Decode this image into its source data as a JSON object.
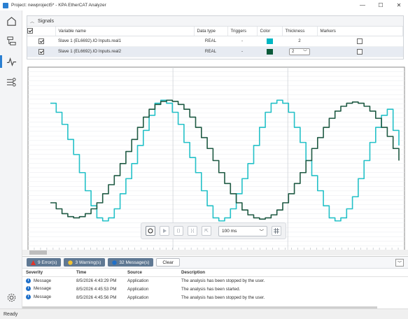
{
  "window": {
    "title": "Project: newproject5* - KPA EtherCAT Analyzer",
    "controls": [
      "—",
      "☐",
      "✕"
    ]
  },
  "sidebar": {
    "items": [
      {
        "icon": "home-icon"
      },
      {
        "icon": "topology-icon"
      },
      {
        "icon": "analyzer-icon",
        "active": true
      },
      {
        "icon": "mapping-icon"
      },
      {
        "icon": "settings-icon"
      }
    ]
  },
  "signals": {
    "header": "Signals",
    "columns": [
      "Variable name",
      "Data type",
      "Triggers",
      "Color",
      "Thickness",
      "Markers"
    ],
    "rows": [
      {
        "name": "Slave 1 (EL6692).IO Inputs.real1",
        "type": "REAL",
        "triggers": "-",
        "color": "#00b7c3",
        "thickness": "2",
        "checked": true
      },
      {
        "name": "Slave 1 (EL6692).IO Inputs.real2",
        "type": "REAL",
        "triggers": "-",
        "color": "#0b5a3a",
        "thickness": "2",
        "checked": true
      }
    ]
  },
  "chart_data": {
    "type": "line",
    "x": [
      0,
      1,
      2,
      3,
      4,
      5,
      6,
      7,
      8,
      9,
      10,
      11,
      12,
      13,
      14,
      15,
      16,
      17,
      18,
      19,
      20,
      21,
      22,
      23,
      24,
      25,
      26,
      27,
      28,
      29,
      30,
      31,
      32,
      33,
      34,
      35,
      36,
      37,
      38,
      39,
      40,
      41,
      42,
      43,
      44,
      45,
      46,
      47,
      48,
      49,
      50,
      51,
      52,
      53,
      54,
      55,
      56,
      57,
      58,
      59,
      60
    ],
    "ylim": [
      -1.2,
      1.2
    ],
    "grid": true,
    "series": [
      {
        "color": "#24c1c8",
        "values": [
          0.95,
          0.8,
          0.6,
          0.35,
          0.1,
          -0.2,
          -0.5,
          -0.75,
          -0.95,
          -1.0,
          -0.95,
          -0.8,
          -0.55,
          -0.3,
          -0.05,
          0.25,
          0.5,
          0.75,
          0.95,
          1.0,
          0.95,
          0.8,
          0.6,
          0.3,
          0.05,
          -0.2,
          -0.5,
          -0.75,
          -0.95,
          -1.0,
          -0.95,
          -0.8,
          -0.55,
          -0.3,
          -0.05,
          0.25,
          0.55,
          0.8,
          0.95,
          1.0,
          0.95,
          0.8,
          0.55,
          0.3,
          0.0,
          -0.25,
          -0.5,
          -0.75,
          -0.95,
          -1.0,
          -0.95,
          -0.8,
          -0.6,
          -0.3,
          0.0,
          0.3,
          0.55,
          0.75,
          0.85,
          0.5,
          0.25
        ]
      },
      {
        "color": "#1f5a43",
        "values": [
          -0.7,
          -0.8,
          -0.88,
          -0.93,
          -0.95,
          -0.93,
          -0.88,
          -0.8,
          -0.7,
          -0.55,
          -0.4,
          -0.25,
          -0.05,
          0.15,
          0.35,
          0.55,
          0.72,
          0.85,
          0.93,
          0.98,
          1.0,
          0.98,
          0.93,
          0.85,
          0.72,
          0.55,
          0.38,
          0.2,
          0.0,
          -0.2,
          -0.38,
          -0.55,
          -0.7,
          -0.82,
          -0.9,
          -0.95,
          -0.97,
          -0.95,
          -0.9,
          -0.82,
          -0.7,
          -0.55,
          -0.38,
          -0.2,
          0.0,
          0.2,
          0.38,
          0.55,
          0.7,
          0.82,
          0.9,
          0.95,
          0.97,
          0.95,
          0.9,
          0.82,
          0.7,
          0.55,
          0.4,
          0.2,
          0.0
        ]
      }
    ]
  },
  "chart_toolbar": {
    "buttons": [
      "record-icon",
      "play-icon",
      "zoom-out-icon",
      "zoom-in-icon",
      "fit-icon"
    ],
    "interval": "100 ms"
  },
  "log": {
    "errors": "9 Error(s)",
    "warnings": "3 Warning(s)",
    "messages": "32 Message(s)",
    "clear": "Clear",
    "columns": [
      "Severity",
      "Time",
      "Source",
      "Description"
    ],
    "rows": [
      {
        "severity": "Message",
        "time": "8/5/2026 4:43:29 PM",
        "source": "Application",
        "description": "The analysis has been stopped by the user."
      },
      {
        "severity": "Message",
        "time": "8/5/2026 4:45:53 PM",
        "source": "Application",
        "description": "The analysis has been started."
      },
      {
        "severity": "Message",
        "time": "8/5/2026 4:45:56 PM",
        "source": "Application",
        "description": "The analysis has been stopped by the user."
      }
    ]
  },
  "status": {
    "text": "Ready"
  }
}
